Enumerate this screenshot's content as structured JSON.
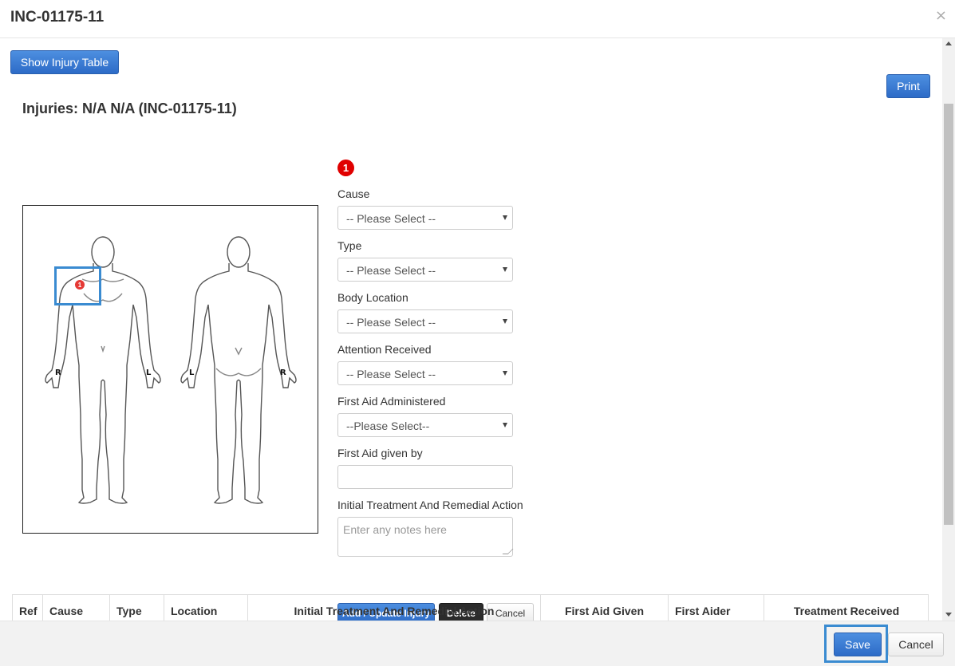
{
  "modal": {
    "title": "INC-01175-11",
    "close_glyph": "×"
  },
  "toolbar": {
    "show_injury_table_label": "Show Injury Table",
    "print_label": "Print"
  },
  "heading": "Injuries: N/A N/A (INC-01175-11)",
  "diagram": {
    "front_right_label": "R",
    "front_left_label": "L",
    "back_left_label": "L",
    "back_right_label": "R",
    "marker_number": "1"
  },
  "form": {
    "ref_number": "1",
    "cause": {
      "label": "Cause",
      "value": "-- Please Select --"
    },
    "type": {
      "label": "Type",
      "value": "-- Please Select --"
    },
    "body_location": {
      "label": "Body Location",
      "value": "-- Please Select --"
    },
    "attention_received": {
      "label": "Attention Received",
      "value": "-- Please Select --"
    },
    "first_aid_administered": {
      "label": "First Aid Administered",
      "value": "--Please Select--"
    },
    "first_aid_given_by": {
      "label": "First Aid given by",
      "value": ""
    },
    "initial_treatment": {
      "label": "Initial Treatment And Remedial Action",
      "placeholder": "Enter any notes here"
    },
    "add_update_label": "Add / Update Injury",
    "delete_label": "Delete",
    "cancel_label": "Cancel"
  },
  "table": {
    "columns": [
      "Ref",
      "Cause",
      "Type",
      "Location",
      "Initial Treatment And Remedial Action",
      "First Aid Given",
      "First Aider",
      "Treatment Received"
    ]
  },
  "footer": {
    "save_label": "Save",
    "cancel_label": "Cancel"
  },
  "colors": {
    "primary": "#2d6bc7",
    "highlight": "#3a8bd1",
    "marker": "#e53935"
  },
  "icons": [
    "close-icon",
    "chevron-down-icon",
    "injury-marker-icon"
  ]
}
